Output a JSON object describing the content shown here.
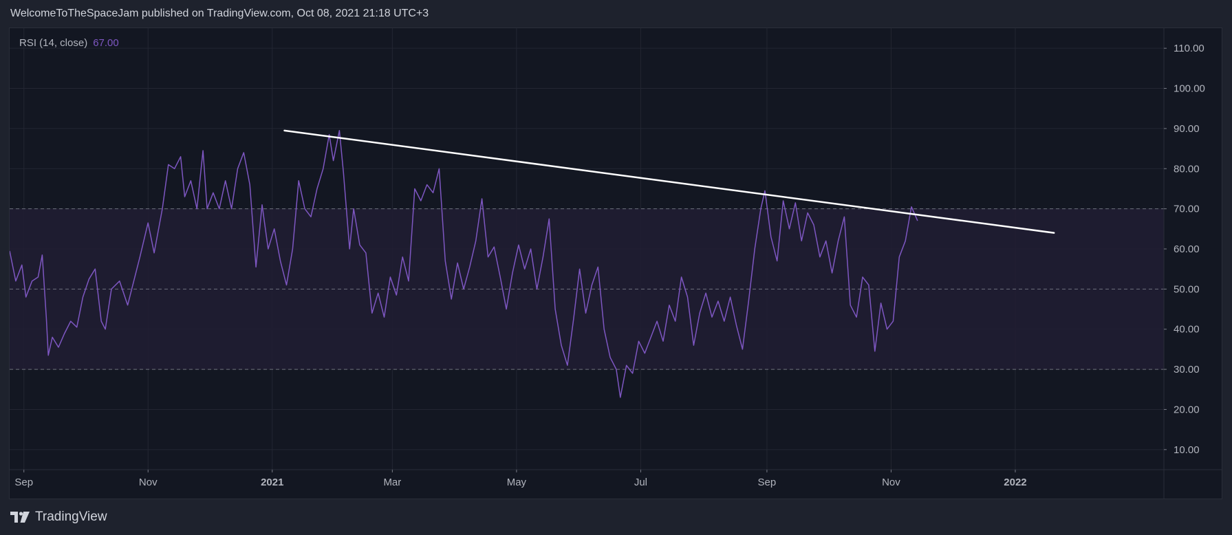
{
  "header": {
    "text": "WelcomeToTheSpaceJam published on TradingView.com, Oct 08, 2021 21:18 UTC+3"
  },
  "indicator": {
    "label": "RSI (14, close)",
    "value": "67.00"
  },
  "footer": {
    "brand": "TradingView",
    "logo_icon": "tradingview-logo-icon"
  },
  "colors": {
    "background": "#131722",
    "page": "#1e222d",
    "grid": "#232632",
    "rsi_line": "#7e57c2",
    "band_fill": "#211d33",
    "band_lines": "#787b86",
    "trend_line": "#ffffff",
    "text": "#b2b5be"
  },
  "chart_data": {
    "type": "line",
    "title": "",
    "xlabel": "",
    "ylabel": "",
    "ylim": [
      5,
      115
    ],
    "xlim": [
      "2020-08-25",
      "2022-03-15"
    ],
    "y_ticks": [
      "10.00",
      "20.00",
      "30.00",
      "40.00",
      "50.00",
      "60.00",
      "70.00",
      "80.00",
      "90.00",
      "100.00",
      "110.00"
    ],
    "y_tick_values": [
      10,
      20,
      30,
      40,
      50,
      60,
      70,
      80,
      90,
      100,
      110
    ],
    "x_ticks": [
      {
        "label": "Sep",
        "date": "2020-09-01"
      },
      {
        "label": "Nov",
        "date": "2020-11-01"
      },
      {
        "label": "2021",
        "date": "2021-01-01"
      },
      {
        "label": "Mar",
        "date": "2021-03-01"
      },
      {
        "label": "May",
        "date": "2021-05-01"
      },
      {
        "label": "Jul",
        "date": "2021-07-01"
      },
      {
        "label": "Sep",
        "date": "2021-09-01"
      },
      {
        "label": "Nov",
        "date": "2021-11-01"
      },
      {
        "label": "2022",
        "date": "2022-01-01"
      }
    ],
    "bands": {
      "upper": 70,
      "middle": 50,
      "lower": 30
    },
    "grid": true,
    "trend_line": {
      "start": {
        "date": "2021-01-07",
        "value": 89.5
      },
      "end": {
        "date": "2022-01-20",
        "value": 64.0
      }
    },
    "series": [
      {
        "name": "RSI (14, close)",
        "points": [
          [
            "2020-08-25",
            59.5
          ],
          [
            "2020-08-28",
            52.0
          ],
          [
            "2020-08-31",
            56.0
          ],
          [
            "2020-09-02",
            48.0
          ],
          [
            "2020-09-05",
            52.0
          ],
          [
            "2020-09-08",
            53.0
          ],
          [
            "2020-09-10",
            58.5
          ],
          [
            "2020-09-12",
            43.0
          ],
          [
            "2020-09-13",
            33.5
          ],
          [
            "2020-09-15",
            38.0
          ],
          [
            "2020-09-18",
            35.5
          ],
          [
            "2020-09-21",
            39.0
          ],
          [
            "2020-09-24",
            42.0
          ],
          [
            "2020-09-27",
            40.5
          ],
          [
            "2020-09-30",
            48.0
          ],
          [
            "2020-10-03",
            52.5
          ],
          [
            "2020-10-06",
            55.0
          ],
          [
            "2020-10-09",
            42.0
          ],
          [
            "2020-10-11",
            40.0
          ],
          [
            "2020-10-14",
            50.0
          ],
          [
            "2020-10-18",
            52.0
          ],
          [
            "2020-10-22",
            46.0
          ],
          [
            "2020-10-25",
            52.0
          ],
          [
            "2020-10-28",
            58.0
          ],
          [
            "2020-11-01",
            66.5
          ],
          [
            "2020-11-04",
            59.0
          ],
          [
            "2020-11-08",
            70.0
          ],
          [
            "2020-11-11",
            81.0
          ],
          [
            "2020-11-14",
            80.0
          ],
          [
            "2020-11-17",
            83.0
          ],
          [
            "2020-11-19",
            73.0
          ],
          [
            "2020-11-22",
            77.0
          ],
          [
            "2020-11-25",
            70.0
          ],
          [
            "2020-11-28",
            84.5
          ],
          [
            "2020-11-30",
            70.0
          ],
          [
            "2020-12-03",
            74.0
          ],
          [
            "2020-12-06",
            70.0
          ],
          [
            "2020-12-09",
            77.0
          ],
          [
            "2020-12-12",
            70.0
          ],
          [
            "2020-12-15",
            80.0
          ],
          [
            "2020-12-18",
            84.0
          ],
          [
            "2020-12-21",
            76.0
          ],
          [
            "2020-12-24",
            55.5
          ],
          [
            "2020-12-27",
            71.0
          ],
          [
            "2020-12-30",
            60.0
          ],
          [
            "2021-01-02",
            65.0
          ],
          [
            "2021-01-05",
            57.0
          ],
          [
            "2021-01-08",
            51.0
          ],
          [
            "2021-01-11",
            60.0
          ],
          [
            "2021-01-14",
            77.0
          ],
          [
            "2021-01-17",
            70.0
          ],
          [
            "2021-01-20",
            68.0
          ],
          [
            "2021-01-23",
            75.0
          ],
          [
            "2021-01-26",
            80.0
          ],
          [
            "2021-01-29",
            88.5
          ],
          [
            "2021-01-31",
            82.0
          ],
          [
            "2021-02-03",
            89.5
          ],
          [
            "2021-02-05",
            79.0
          ],
          [
            "2021-02-08",
            60.0
          ],
          [
            "2021-02-10",
            70.0
          ],
          [
            "2021-02-13",
            61.0
          ],
          [
            "2021-02-16",
            59.0
          ],
          [
            "2021-02-19",
            44.0
          ],
          [
            "2021-02-22",
            49.0
          ],
          [
            "2021-02-25",
            43.0
          ],
          [
            "2021-02-28",
            53.0
          ],
          [
            "2021-03-03",
            48.5
          ],
          [
            "2021-03-06",
            58.0
          ],
          [
            "2021-03-09",
            52.0
          ],
          [
            "2021-03-12",
            75.0
          ],
          [
            "2021-03-15",
            72.0
          ],
          [
            "2021-03-18",
            76.0
          ],
          [
            "2021-03-21",
            74.0
          ],
          [
            "2021-03-24",
            80.0
          ],
          [
            "2021-03-27",
            57.0
          ],
          [
            "2021-03-30",
            47.5
          ],
          [
            "2021-04-02",
            56.5
          ],
          [
            "2021-04-05",
            50.0
          ],
          [
            "2021-04-08",
            55.5
          ],
          [
            "2021-04-11",
            62.0
          ],
          [
            "2021-04-14",
            72.5
          ],
          [
            "2021-04-17",
            58.0
          ],
          [
            "2021-04-20",
            60.5
          ],
          [
            "2021-04-23",
            53.0
          ],
          [
            "2021-04-26",
            45.0
          ],
          [
            "2021-04-29",
            54.0
          ],
          [
            "2021-05-02",
            61.0
          ],
          [
            "2021-05-05",
            55.0
          ],
          [
            "2021-05-08",
            60.0
          ],
          [
            "2021-05-11",
            50.0
          ],
          [
            "2021-05-14",
            58.0
          ],
          [
            "2021-05-17",
            67.5
          ],
          [
            "2021-05-20",
            45.0
          ],
          [
            "2021-05-23",
            36.0
          ],
          [
            "2021-05-26",
            31.0
          ],
          [
            "2021-05-29",
            42.5
          ],
          [
            "2021-06-01",
            55.0
          ],
          [
            "2021-06-04",
            44.0
          ],
          [
            "2021-06-07",
            51.0
          ],
          [
            "2021-06-10",
            55.5
          ],
          [
            "2021-06-13",
            40.0
          ],
          [
            "2021-06-16",
            33.0
          ],
          [
            "2021-06-19",
            30.0
          ],
          [
            "2021-06-21",
            23.0
          ],
          [
            "2021-06-24",
            31.0
          ],
          [
            "2021-06-27",
            29.0
          ],
          [
            "2021-06-30",
            37.0
          ],
          [
            "2021-07-03",
            34.0
          ],
          [
            "2021-07-06",
            38.0
          ],
          [
            "2021-07-09",
            42.0
          ],
          [
            "2021-07-12",
            37.0
          ],
          [
            "2021-07-15",
            46.0
          ],
          [
            "2021-07-18",
            42.0
          ],
          [
            "2021-07-21",
            53.0
          ],
          [
            "2021-07-24",
            48.0
          ],
          [
            "2021-07-27",
            36.0
          ],
          [
            "2021-07-30",
            44.0
          ],
          [
            "2021-08-02",
            49.0
          ],
          [
            "2021-08-05",
            43.0
          ],
          [
            "2021-08-08",
            47.0
          ],
          [
            "2021-08-11",
            42.0
          ],
          [
            "2021-08-14",
            48.0
          ],
          [
            "2021-08-17",
            41.0
          ],
          [
            "2021-08-20",
            35.0
          ],
          [
            "2021-08-23",
            47.0
          ],
          [
            "2021-08-26",
            60.0
          ],
          [
            "2021-08-29",
            70.0
          ],
          [
            "2021-08-31",
            74.5
          ],
          [
            "2021-09-03",
            63.0
          ],
          [
            "2021-09-06",
            57.0
          ],
          [
            "2021-09-09",
            72.0
          ],
          [
            "2021-09-12",
            65.0
          ],
          [
            "2021-09-15",
            71.5
          ],
          [
            "2021-09-18",
            62.0
          ],
          [
            "2021-09-21",
            69.0
          ],
          [
            "2021-09-24",
            66.0
          ],
          [
            "2021-09-27",
            58.0
          ],
          [
            "2021-09-30",
            62.0
          ],
          [
            "2021-10-03",
            54.0
          ],
          [
            "2021-10-06",
            62.0
          ],
          [
            "2021-10-09",
            68.0
          ],
          [
            "2021-10-12",
            46.0
          ],
          [
            "2021-10-15",
            43.0
          ],
          [
            "2021-10-18",
            53.0
          ],
          [
            "2021-10-21",
            51.0
          ],
          [
            "2021-10-24",
            34.5
          ],
          [
            "2021-10-27",
            46.5
          ],
          [
            "2021-10-30",
            40.0
          ],
          [
            "2021-11-02",
            42.0
          ],
          [
            "2021-11-05",
            58.0
          ],
          [
            "2021-11-08",
            62.0
          ],
          [
            "2021-11-11",
            70.5
          ],
          [
            "2021-11-14",
            67.0
          ]
        ]
      }
    ]
  }
}
